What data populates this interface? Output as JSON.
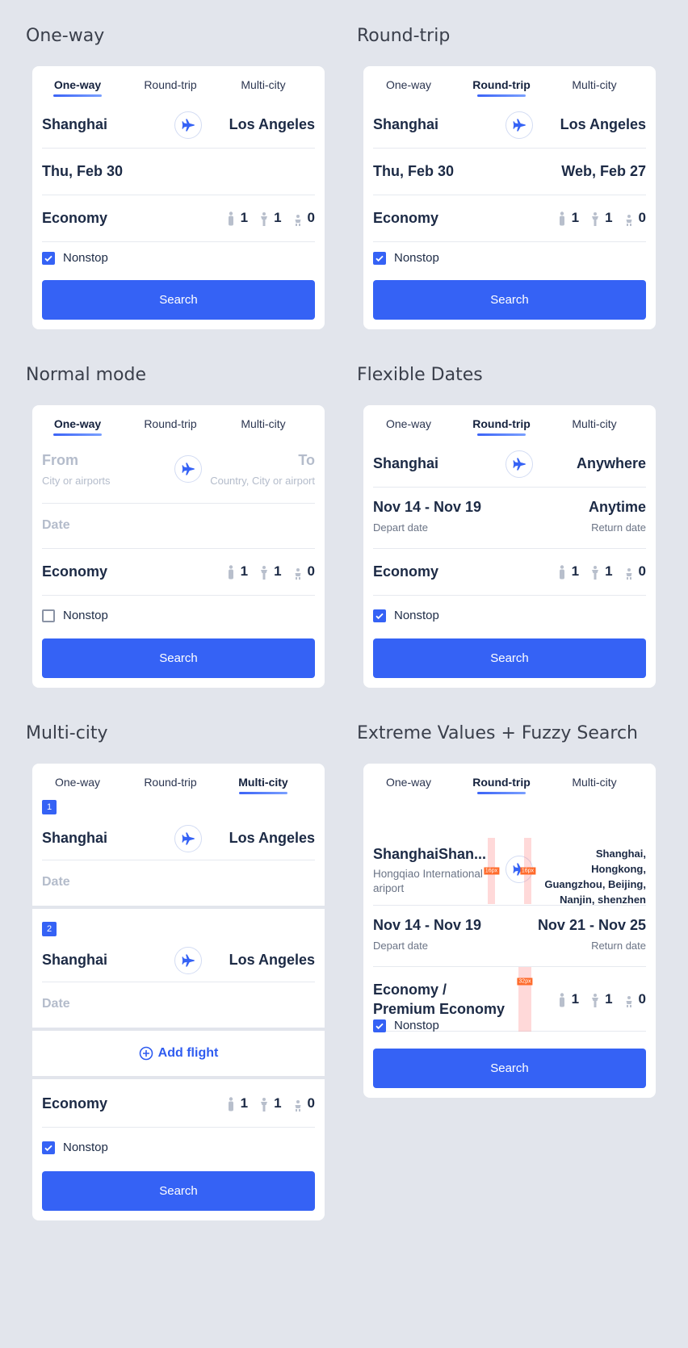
{
  "sections": {
    "one_way": "One-way",
    "round_trip": "Round-trip",
    "normal_mode": "Normal mode",
    "flexible_dates": "Flexible Dates",
    "multi_city": "Multi-city",
    "extreme": "Extreme Values + Fuzzy Search"
  },
  "tabs": {
    "one_way": "One-way",
    "round_trip": "Round-trip",
    "multi_city": "Multi-city"
  },
  "common": {
    "economy": "Economy",
    "nonstop": "Nonstop",
    "search": "Search",
    "adults": "1",
    "children": "1",
    "infants": "0",
    "date_placeholder": "Date"
  },
  "one_way": {
    "from": "Shanghai",
    "to": "Los Angeles",
    "date": "Thu, Feb 30"
  },
  "round_trip": {
    "from": "Shanghai",
    "to": "Los Angeles",
    "depart": "Thu, Feb 30",
    "return": "Web, Feb 27"
  },
  "normal": {
    "from": "From",
    "from_hint": "City or airports",
    "to": "To",
    "to_hint": "Country, City or airport",
    "date": "Date"
  },
  "flexible": {
    "from": "Shanghai",
    "to": "Anywhere",
    "depart": "Nov 14 - Nov 19",
    "depart_hint": "Depart date",
    "return": "Anytime",
    "return_hint": "Return date"
  },
  "multi": {
    "flight1_badge": "1",
    "flight1_from": "Shanghai",
    "flight1_to": "Los Angeles",
    "flight2_badge": "2",
    "flight2_from": "Shanghai",
    "flight2_to": "Los Angeles",
    "add_flight": "Add flight"
  },
  "extreme": {
    "from": "ShanghaiShan...",
    "from_hint": "Hongqiao International ariport",
    "to": "Shanghai, Hongkong, Guangzhou, Beijing, Nanjin, shenzhen",
    "depart": "Nov 14 - Nov 19",
    "depart_hint": "Depart date",
    "return": "Nov 21 - Nov 25",
    "return_hint": "Return date",
    "cabin": "Economy / Premium Economy",
    "gap_label_16": "16px",
    "gap_label_32": "32px"
  },
  "colors": {
    "accent": "#3562f5",
    "background": "#e2e5ec",
    "text": "#1c2a45"
  }
}
